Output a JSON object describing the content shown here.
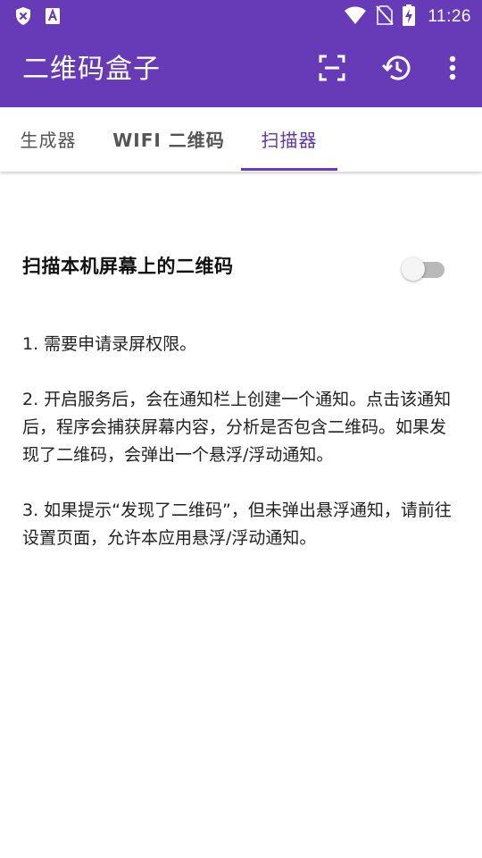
{
  "status_bar": {
    "time": "11:26",
    "left_icons": [
      "shield-x-icon",
      "a-notification-icon"
    ],
    "right_icons": [
      "wifi-icon",
      "no-sim-icon",
      "battery-charging-icon"
    ]
  },
  "app_bar": {
    "title": "二维码盒子",
    "actions": [
      "scan-icon",
      "history-icon",
      "more-vert-icon"
    ],
    "color": "#673ab7"
  },
  "tabs": [
    {
      "label": "生成器",
      "active": false
    },
    {
      "label": "WIFI 二维码",
      "active": false
    },
    {
      "label": "扫描器",
      "active": true
    }
  ],
  "scanner": {
    "toggle_label": "扫描本机屏幕上的二维码",
    "toggle_on": false,
    "instructions": [
      "1. 需要申请录屏权限。",
      "2. 开启服务后，会在通知栏上创建一个通知。点击该通知后，程序会捕获屏幕内容，分析是否包含二维码。如果发现了二维码，会弹出一个悬浮/浮动通知。",
      "3. 如果提示“发现了二维码”，但未弹出悬浮通知，请前往设置页面，允许本应用悬浮/浮动通知。"
    ]
  }
}
